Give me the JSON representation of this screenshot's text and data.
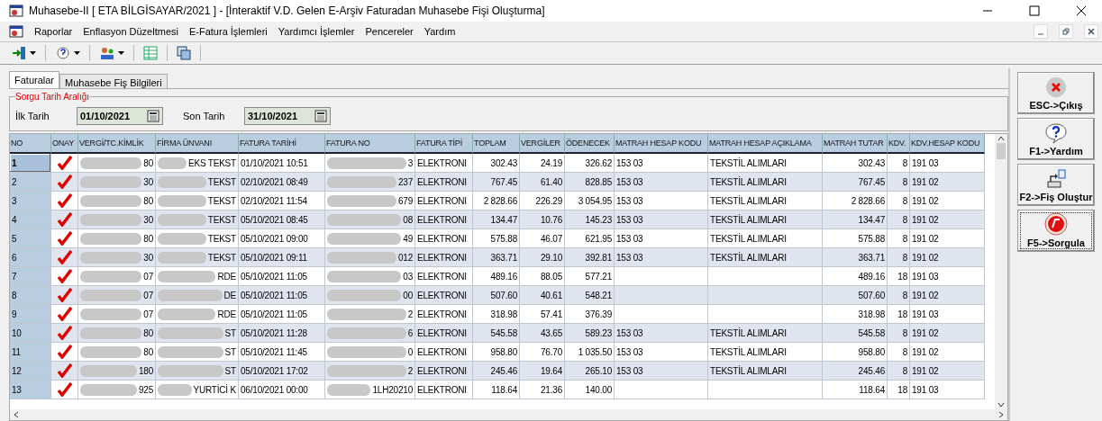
{
  "window": {
    "title": "Muhasebe-II  [ ETA BİLGİSAYAR/2021 ]  - [İnteraktif V.D. Gelen E-Arşiv Faturadan Muhasebe Fişi Oluşturma]"
  },
  "menu": [
    "Raporlar",
    "Enflasyon Düzeltmesi",
    "E-Fatura İşlemleri",
    "Yardımcı İşlemler",
    "Pencereler",
    "Yardım"
  ],
  "tabs": [
    {
      "label": "Faturalar",
      "selected": true
    },
    {
      "label": "Muhasebe Fiş Bilgileri",
      "selected": false
    }
  ],
  "date_range": {
    "title": "Sorgu Tarih Aralığı",
    "start_label": "İlk Tarih",
    "start": "01/10/2021",
    "end_label": "Son Tarih",
    "end": "31/10/2021"
  },
  "table": {
    "columns": [
      {
        "label": "NO",
        "kind": "rowhead"
      },
      {
        "label": "ONAY",
        "kind": "check"
      },
      {
        "label": "VERGİ/TC.KİMLİK",
        "kind": "masked"
      },
      {
        "label": "FİRMA ÜNVANI",
        "kind": "masked"
      },
      {
        "label": "FATURA TARİHİ",
        "kind": "text"
      },
      {
        "label": "FATURA NO",
        "kind": "masked"
      },
      {
        "label": "FATURA TİPİ",
        "kind": "text"
      },
      {
        "label": "TOPLAM",
        "kind": "number"
      },
      {
        "label": "VERGİLER",
        "kind": "number"
      },
      {
        "label": "ÖDENECEK",
        "kind": "number"
      },
      {
        "label": "MATRAH HESAP KODU",
        "kind": "text"
      },
      {
        "label": "MATRAH HESAP AÇIKLAMA",
        "kind": "text"
      },
      {
        "label": "MATRAH TUTAR",
        "kind": "number"
      },
      {
        "label": "KDV.",
        "kind": "number"
      },
      {
        "label": "KDV.HESAP KODU",
        "kind": "text"
      }
    ],
    "rows": [
      {
        "selected": true,
        "cells": [
          "1",
          true,
          "80",
          "EKS TEKST",
          "01/10/2021 10:51",
          "3",
          "ELEKTRONI",
          "302.43",
          "24.19",
          "326.62",
          "153 03",
          "TEKSTİL ALIMLARI",
          "302.43",
          "8",
          "191 03"
        ]
      },
      {
        "selected": false,
        "cells": [
          "2",
          true,
          "30",
          "TEKST",
          "02/10/2021 08:49",
          "237",
          "ELEKTRONI",
          "767.45",
          "61.40",
          "828.85",
          "153 03",
          "TEKSTİL ALIMLARI",
          "767.45",
          "8",
          "191 02"
        ]
      },
      {
        "selected": false,
        "cells": [
          "3",
          true,
          "80",
          "TEKST",
          "02/10/2021 11:54",
          "679",
          "ELEKTRONI",
          "2 828.66",
          "226.29",
          "3 054.95",
          "153 03",
          "TEKSTİL ALIMLARI",
          "2 828.66",
          "8",
          "191 02"
        ]
      },
      {
        "selected": false,
        "cells": [
          "4",
          true,
          "30",
          "TEKST",
          "05/10/2021 08:45",
          "08",
          "ELEKTRONI",
          "134.47",
          "10.76",
          "145.23",
          "153 03",
          "TEKSTİL ALIMLARI",
          "134.47",
          "8",
          "191 02"
        ]
      },
      {
        "selected": false,
        "cells": [
          "5",
          true,
          "80",
          "TEKST",
          "05/10/2021 09:00",
          "49",
          "ELEKTRONI",
          "575.88",
          "46.07",
          "621.95",
          "153 03",
          "TEKSTİL ALIMLARI",
          "575.88",
          "8",
          "191 02"
        ]
      },
      {
        "selected": false,
        "cells": [
          "6",
          true,
          "30",
          "TEKST",
          "05/10/2021 09:11",
          "012",
          "ELEKTRONI",
          "363.71",
          "29.10",
          "392.81",
          "153 03",
          "TEKSTİL ALIMLARI",
          "363.71",
          "8",
          "191 02"
        ]
      },
      {
        "selected": false,
        "cells": [
          "7",
          true,
          "07",
          "RDE",
          "05/10/2021 11:05",
          "03",
          "ELEKTRONI",
          "489.16",
          "88.05",
          "577.21",
          null,
          null,
          "489.16",
          "18",
          "191 03"
        ]
      },
      {
        "selected": false,
        "cells": [
          "8",
          true,
          "07",
          "DE",
          "05/10/2021 11:05",
          "00",
          "ELEKTRONI",
          "507.60",
          "40.61",
          "548.21",
          null,
          null,
          "507.60",
          "8",
          "191 02"
        ]
      },
      {
        "selected": false,
        "cells": [
          "9",
          true,
          "07",
          "RDE",
          "05/10/2021 11:05",
          "2",
          "ELEKTRONI",
          "318.98",
          "57.41",
          "376.39",
          null,
          null,
          "318.98",
          "18",
          "191 03"
        ]
      },
      {
        "selected": false,
        "cells": [
          "10",
          true,
          "80",
          "ST",
          "05/10/2021 11:28",
          "6",
          "ELEKTRONI",
          "545.58",
          "43.65",
          "589.23",
          "153 03",
          "TEKSTİL ALIMLARI",
          "545.58",
          "8",
          "191 02"
        ]
      },
      {
        "selected": false,
        "cells": [
          "11",
          true,
          "80",
          "ST",
          "05/10/2021 11:45",
          "0",
          "ELEKTRONI",
          "958.80",
          "76.70",
          "1 035.50",
          "153 03",
          "TEKSTİL ALIMLARI",
          "958.80",
          "8",
          "191 02"
        ]
      },
      {
        "selected": false,
        "cells": [
          "12",
          true,
          "180",
          "ST",
          "05/10/2021 17:02",
          "2",
          "ELEKTRONI",
          "245.46",
          "19.64",
          "265.10",
          "153 03",
          "TEKSTİL ALIMLARI",
          "245.46",
          "8",
          "191 02"
        ]
      },
      {
        "selected": false,
        "cells": [
          "13",
          true,
          "925",
          "YURTİCİ K",
          "06/10/2021 00:00",
          "1LH20210",
          "ELEKTRONI",
          "118.64",
          "21.36",
          "140.00",
          null,
          null,
          "118.64",
          "18",
          "191 03"
        ]
      }
    ]
  },
  "actions": [
    {
      "kind": "exit",
      "label": "ESC->Çıkış"
    },
    {
      "kind": "help",
      "label": "F1->Yardım"
    },
    {
      "kind": "voucher",
      "label": "F2->Fiş Oluştur"
    },
    {
      "kind": "query",
      "label": "F5->Sorgula"
    }
  ]
}
